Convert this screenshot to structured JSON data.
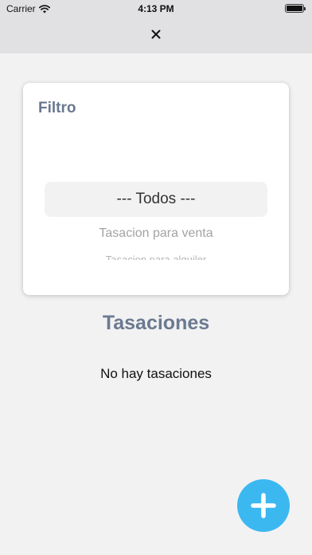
{
  "status_bar": {
    "carrier": "Carrier",
    "time": "4:13 PM"
  },
  "header": {
    "close_icon": "close-icon"
  },
  "filter": {
    "title": "Filtro",
    "selected": "--- Todos ---",
    "options": [
      "Tasacion para venta",
      "Tasacion para alquiler"
    ]
  },
  "main": {
    "title": "Tasaciones",
    "empty_message": "No hay tasaciones"
  },
  "fab": {
    "icon": "plus-icon",
    "color": "#3cb8f1"
  }
}
